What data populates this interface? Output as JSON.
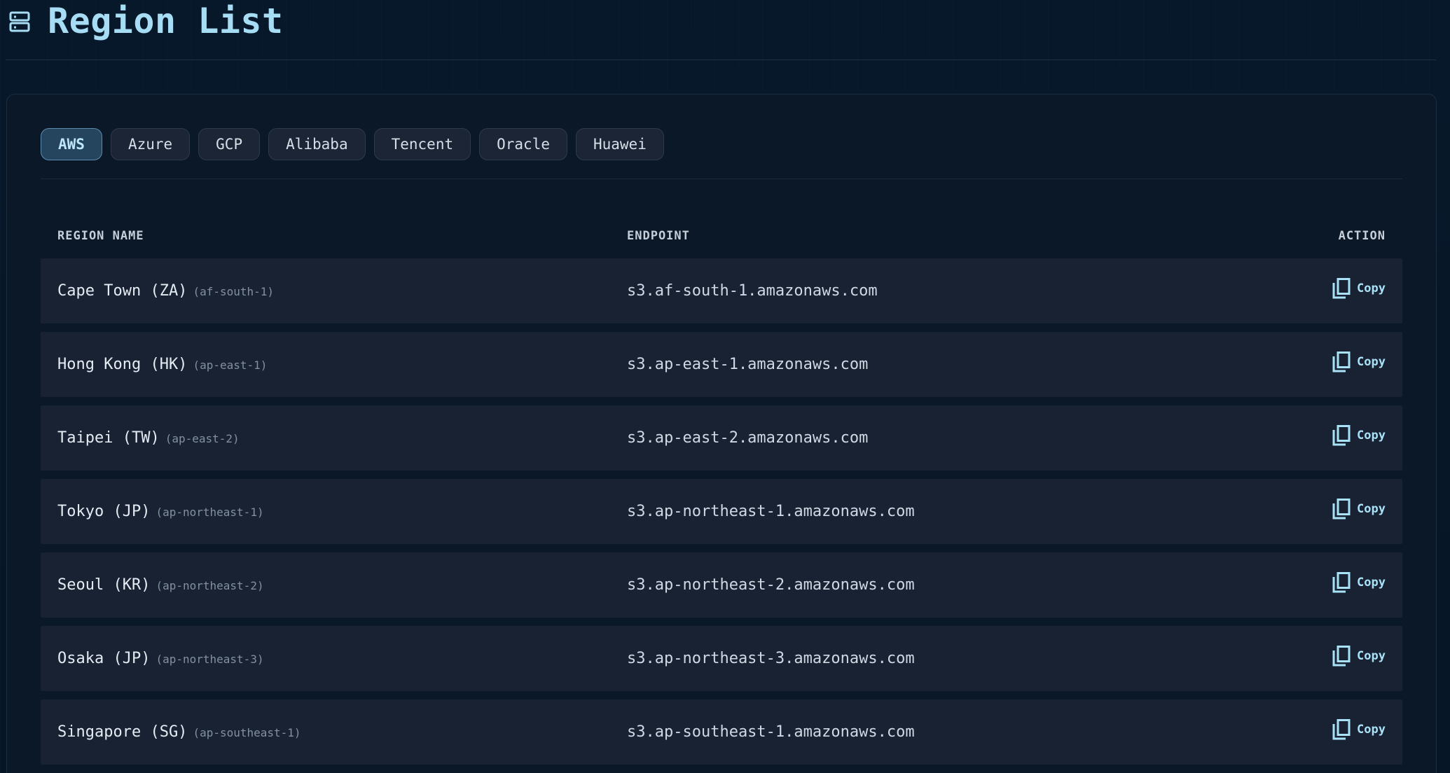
{
  "header": {
    "title": "Region List",
    "icon": "server-icon"
  },
  "tabs": [
    {
      "label": "AWS",
      "active": true
    },
    {
      "label": "Azure",
      "active": false
    },
    {
      "label": "GCP",
      "active": false
    },
    {
      "label": "Alibaba",
      "active": false
    },
    {
      "label": "Tencent",
      "active": false
    },
    {
      "label": "Oracle",
      "active": false
    },
    {
      "label": "Huawei",
      "active": false
    }
  ],
  "table": {
    "columns": {
      "region": "REGION NAME",
      "endpoint": "ENDPOINT",
      "action": "ACTION"
    },
    "copy_label": "Copy",
    "rows": [
      {
        "name": "Cape Town (ZA)",
        "code": "(af-south-1)",
        "endpoint": "s3.af-south-1.amazonaws.com"
      },
      {
        "name": "Hong Kong (HK)",
        "code": "(ap-east-1)",
        "endpoint": "s3.ap-east-1.amazonaws.com"
      },
      {
        "name": "Taipei (TW)",
        "code": "(ap-east-2)",
        "endpoint": "s3.ap-east-2.amazonaws.com"
      },
      {
        "name": "Tokyo (JP)",
        "code": "(ap-northeast-1)",
        "endpoint": "s3.ap-northeast-1.amazonaws.com"
      },
      {
        "name": "Seoul (KR)",
        "code": "(ap-northeast-2)",
        "endpoint": "s3.ap-northeast-2.amazonaws.com"
      },
      {
        "name": "Osaka (JP)",
        "code": "(ap-northeast-3)",
        "endpoint": "s3.ap-northeast-3.amazonaws.com"
      },
      {
        "name": "Singapore (SG)",
        "code": "(ap-southeast-1)",
        "endpoint": "s3.ap-southeast-1.amazonaws.com"
      }
    ]
  },
  "colors": {
    "accent": "#a7ddf4",
    "background": "#06131f",
    "panel": "#0b1828",
    "row": "#182233",
    "active_tab": "#25445e"
  }
}
